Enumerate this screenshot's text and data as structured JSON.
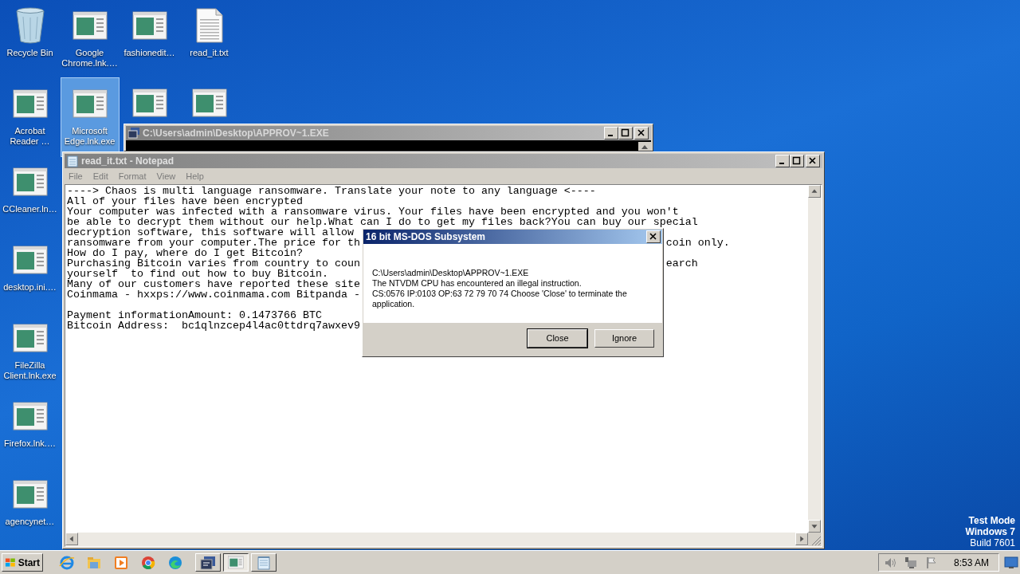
{
  "desktop": {
    "icon_columns": [
      [
        {
          "kind": "recycle",
          "label": "Recycle Bin",
          "selected": false
        },
        {
          "kind": "shortcut",
          "label": "Acrobat Reader …",
          "selected": false
        },
        {
          "kind": "shortcut",
          "label": "CCleaner.ln…",
          "selected": false
        },
        {
          "kind": "shortcut",
          "label": "desktop.ini.…",
          "selected": false
        },
        {
          "kind": "shortcut",
          "label": "FileZilla Client.lnk.exe",
          "selected": false
        },
        {
          "kind": "shortcut",
          "label": "Firefox.lnk.…",
          "selected": false
        },
        {
          "kind": "shortcut",
          "label": "agencynet…",
          "selected": false
        }
      ],
      [
        {
          "kind": "shortcut",
          "label": "Google Chrome.lnk.…",
          "selected": false
        },
        {
          "kind": "shortcut",
          "label": "Microsoft Edge.lnk.exe",
          "selected": true
        }
      ],
      [
        {
          "kind": "shortcut",
          "label": "fashionedit…",
          "selected": false
        },
        {
          "kind": "shortcut",
          "selected": false
        }
      ],
      [
        {
          "kind": "text",
          "label": "read_it.txt",
          "selected": false
        },
        {
          "kind": "shortcut",
          "selected": false
        }
      ]
    ],
    "os_notice": [
      "Test Mode",
      "Windows 7",
      "Build 7601"
    ]
  },
  "console_window": {
    "title": "C:\\Users\\admin\\Desktop\\APPROV~1.EXE"
  },
  "notepad": {
    "title": "read_it.txt - Notepad",
    "menu": [
      "File",
      "Edit",
      "Format",
      "View",
      "Help"
    ],
    "lines": [
      {
        "left": "----> Chaos is multi language ransomware. Translate your note to any language <----"
      },
      {
        "left": "All of your files have been encrypted"
      },
      {
        "left": "Your computer was infected with a ransomware virus. Your files have been encrypted and you won't"
      },
      {
        "left": "be able to decrypt them without our help.What can I do to get my files back?You can buy our special"
      },
      {
        "left": "decryption software, this software will allow"
      },
      {
        "left": "ransomware from your computer.The price for th",
        "right": "coin only."
      },
      {
        "left": "How do I pay, where do I get Bitcoin?"
      },
      {
        "left": "Purchasing Bitcoin varies from country to coun",
        "right": "earch"
      },
      {
        "left": "yourself  to find out how to buy Bitcoin."
      },
      {
        "left": "Many of our customers have reported these site"
      },
      {
        "left": "Coinmama - hxxps://www.coinmama.com Bitpanda -"
      },
      {
        "blank_line_before": true,
        "left": "Payment informationAmount: 0.1473766 BTC"
      },
      {
        "left": "Bitcoin Address:  bc1qlnzcep4l4ac0ttdrq7awxev9"
      }
    ]
  },
  "dialog": {
    "title": "16 bit MS-DOS Subsystem",
    "message": [
      "C:\\Users\\admin\\Desktop\\APPROV~1.EXE",
      "The NTVDM CPU has encountered an illegal instruction.",
      "CS:0576 IP:0103 OP:63 72 79 70 74 Choose 'Close' to terminate the application."
    ],
    "buttons": [
      "Close",
      "Ignore"
    ]
  },
  "taskbar": {
    "start": "Start",
    "quick_launch": [
      {
        "kind": "ie"
      },
      {
        "kind": "explorer"
      },
      {
        "kind": "media"
      },
      {
        "kind": "chrome"
      },
      {
        "kind": "edge"
      }
    ],
    "tasks": [
      {
        "kind": "dos",
        "selected": false
      },
      {
        "kind": "window",
        "selected": true
      },
      {
        "kind": "notepad",
        "selected": false
      }
    ],
    "clock": "8:53 AM"
  }
}
